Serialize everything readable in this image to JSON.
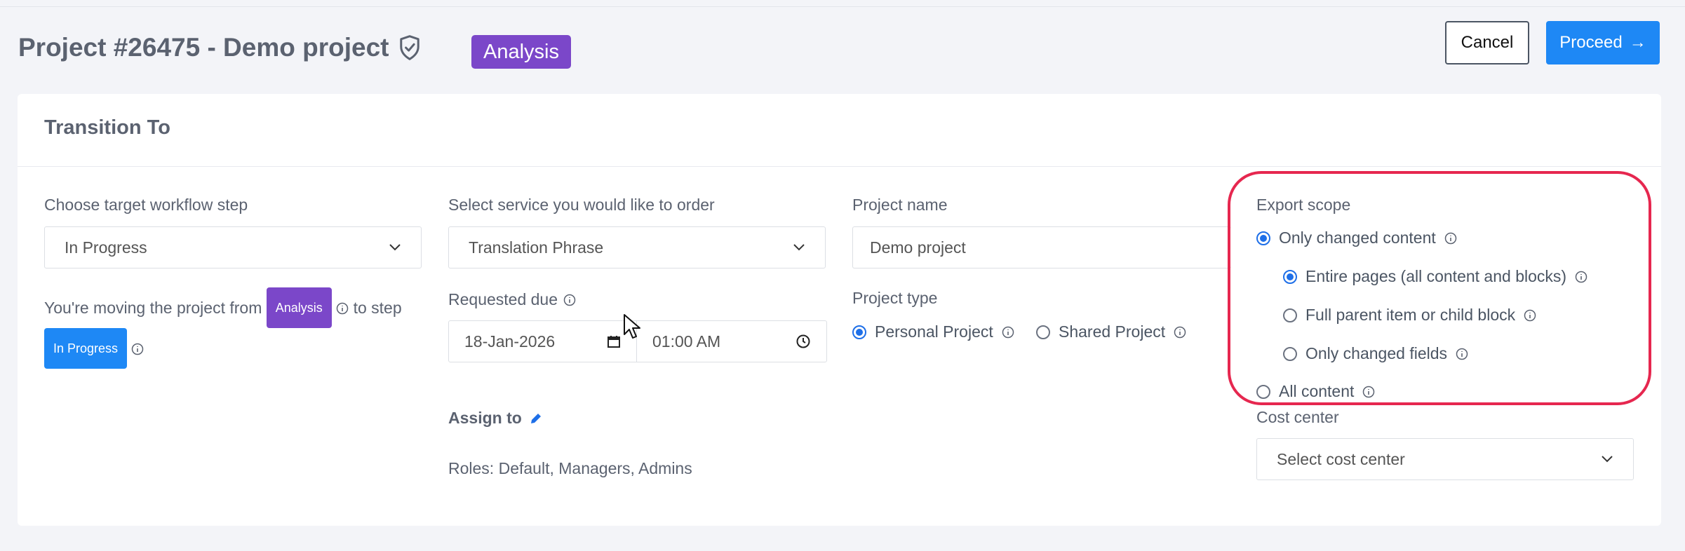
{
  "header": {
    "title": "Project #26475 - Demo project",
    "status_badge": "Analysis",
    "cancel_label": "Cancel",
    "proceed_label": "Proceed",
    "proceed_arrow": "→"
  },
  "card": {
    "title": "Transition To"
  },
  "workflow": {
    "label": "Choose target workflow step",
    "selected": "In Progress",
    "moving_prefix": "You're moving the project from",
    "from_tag": "Analysis",
    "to_text": "to step",
    "to_tag": "In Progress"
  },
  "service": {
    "label": "Select service you would like to order",
    "selected": "Translation Phrase",
    "due_label": "Requested due",
    "due_date": "18-Jan-2026",
    "due_time": "01:00 AM",
    "assign_label": "Assign to",
    "roles_text": "Roles: Default, Managers, Admins"
  },
  "project": {
    "name_label": "Project name",
    "name_value": "Demo project",
    "type_label": "Project type",
    "type_options": [
      "Personal Project",
      "Shared Project"
    ],
    "type_selected": "Personal Project"
  },
  "export": {
    "label": "Export scope",
    "option_changed": "Only changed content",
    "sub_entire": "Entire pages (all content and blocks)",
    "sub_parent": "Full parent item or child block",
    "sub_fields": "Only changed fields",
    "option_all": "All content",
    "selected": "Only changed content",
    "sub_selected": "Entire pages (all content and blocks)"
  },
  "cost_center": {
    "label": "Cost center",
    "placeholder": "Select cost center"
  },
  "colors": {
    "accent_blue": "#1e88f5",
    "analysis_purple": "#7b47c9",
    "highlight_red": "#e6274f"
  }
}
